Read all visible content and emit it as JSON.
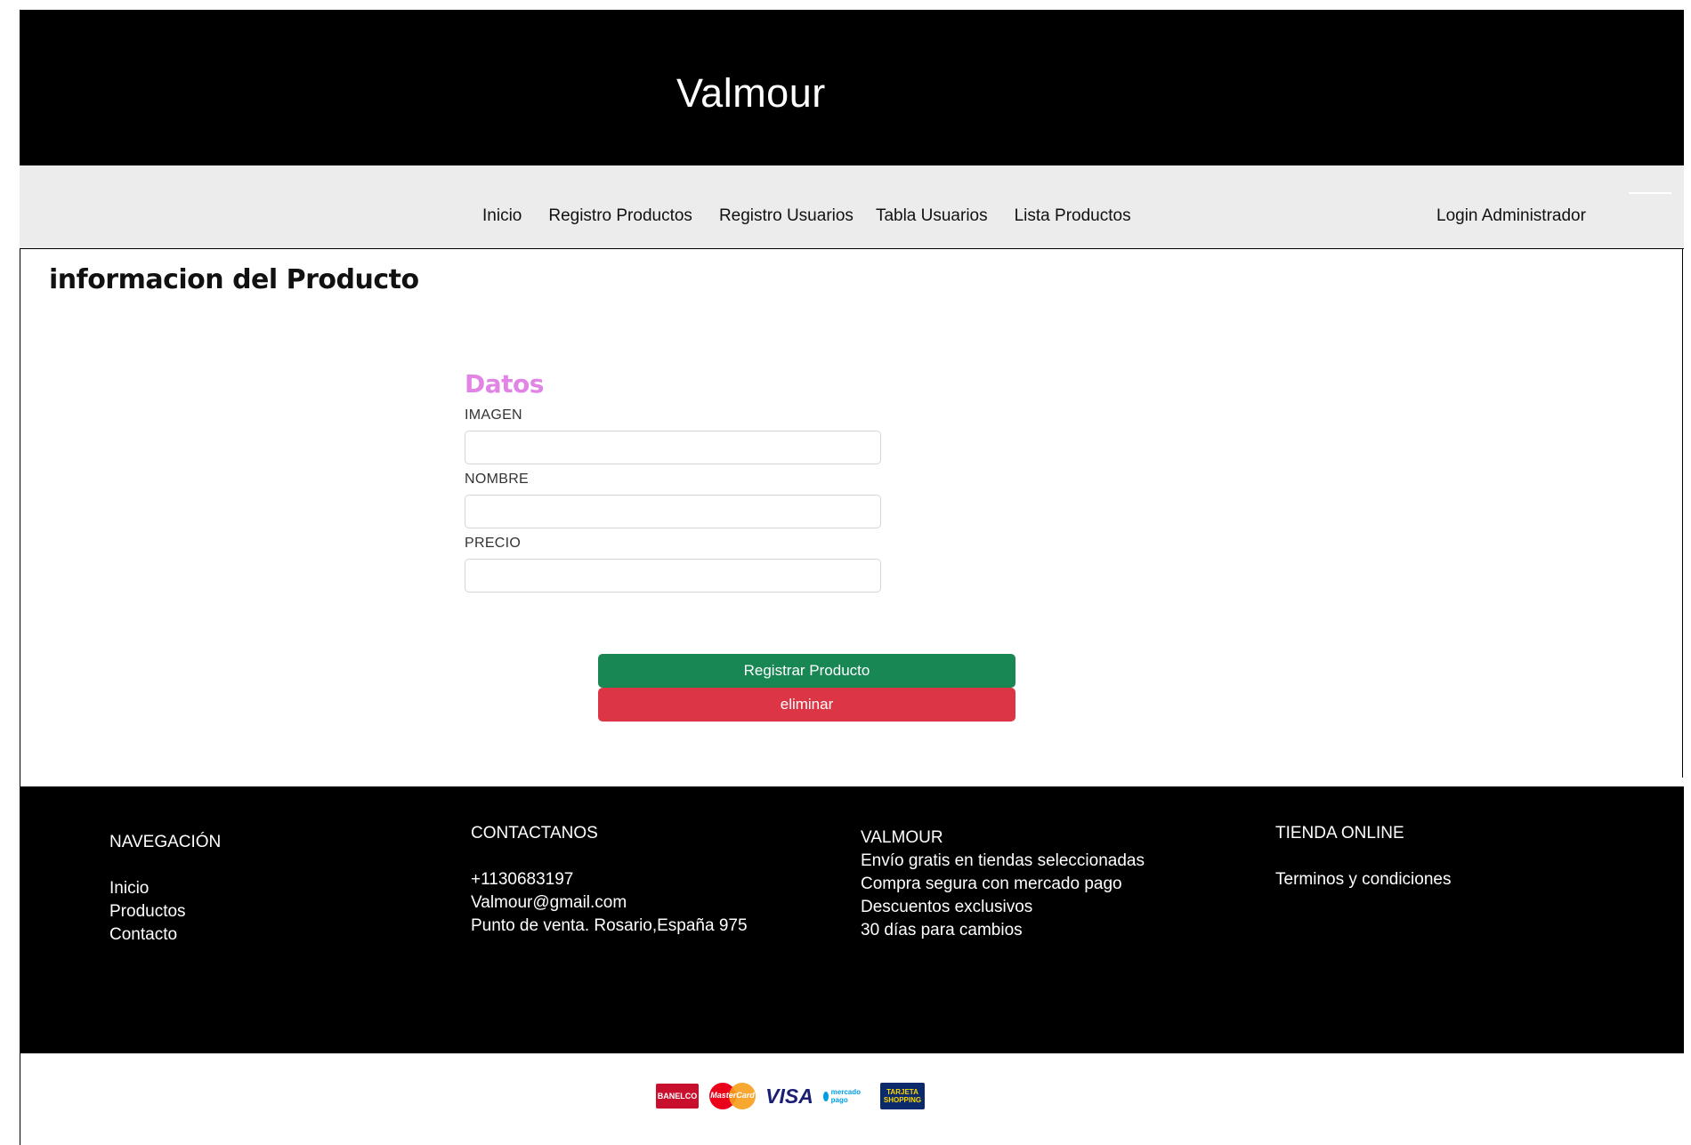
{
  "header": {
    "brand": "Valmour"
  },
  "nav": {
    "links": [
      "Inicio",
      "Registro Productos",
      "Registro Usuarios",
      "Tabla Usuarios",
      "Lista Productos"
    ],
    "login": "Login Administrador"
  },
  "page": {
    "title": "informacion del Producto"
  },
  "form": {
    "heading": "Datos",
    "fields": [
      {
        "label": "IMAGEN",
        "value": "",
        "placeholder": ""
      },
      {
        "label": "NOMBRE",
        "value": "",
        "placeholder": ""
      },
      {
        "label": "PRECIO",
        "value": "",
        "placeholder": ""
      }
    ],
    "submit_label": "Registrar Producto",
    "delete_label": "eliminar"
  },
  "footer": {
    "navegacion": {
      "title": "NAVEGACIÓN",
      "links": [
        "Inicio",
        "Productos",
        "Contacto"
      ]
    },
    "contacto": {
      "title": "CONTACTANOS",
      "items": [
        "+1130683197",
        "Valmour@gmail.com",
        "Punto de venta. Rosario,España 975"
      ]
    },
    "valmour": {
      "title": "VALMOUR",
      "items": [
        "Envío gratis en tiendas seleccionadas",
        "Compra segura con mercado pago",
        "Descuentos exclusivos",
        "30 días para cambios"
      ]
    },
    "tienda": {
      "title": "TIENDA ONLINE",
      "links": [
        "Terminos y condiciones"
      ]
    }
  },
  "payments": {
    "logos": [
      "BANELCO",
      "MasterCard",
      "VISA",
      "mercado pago",
      "TARJETA SHOPPING"
    ]
  },
  "colors": {
    "header_bg": "#000000",
    "navbar_bg": "#ececec",
    "heading_accent": "#e283e6",
    "success": "#198754",
    "danger": "#dc3545"
  }
}
